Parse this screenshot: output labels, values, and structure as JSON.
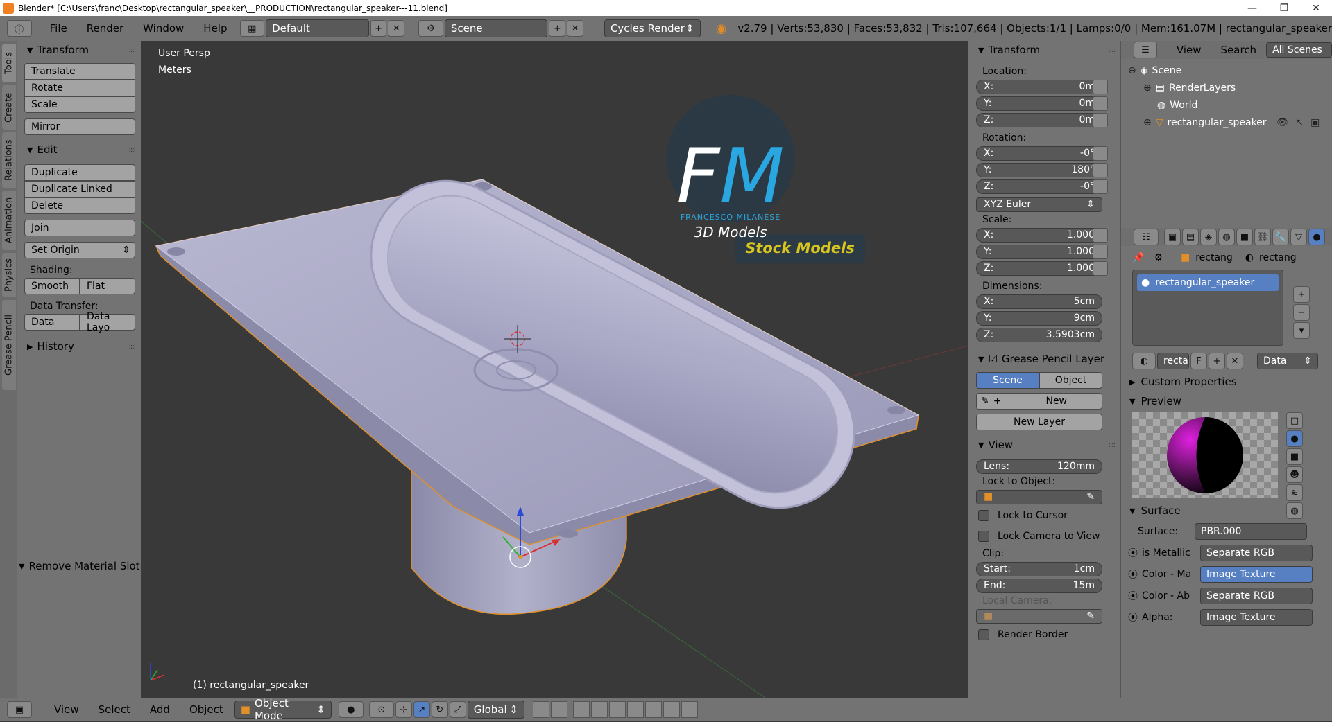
{
  "window": {
    "title": "Blender* [C:\\Users\\franc\\Desktop\\rectangular_speaker\\__PRODUCTION\\rectangular_speaker---11.blend]",
    "minimize": "—",
    "maximize": "❐",
    "close": "✕"
  },
  "topbar": {
    "menus": [
      "File",
      "Render",
      "Window",
      "Help"
    ],
    "layout": "Default",
    "scene": "Scene",
    "engine": "Cycles Render",
    "stats": "v2.79 | Verts:53,830 | Faces:53,832 | Tris:107,664 | Objects:1/1 | Lamps:0/0 | Mem:161.07M | rectangular_speaker"
  },
  "left_tabs": [
    "Tools",
    "Create",
    "Relations",
    "Animation",
    "Physics",
    "Grease Pencil"
  ],
  "toolshelf": {
    "transform_title": "Transform",
    "transform_buttons": [
      "Translate",
      "Rotate",
      "Scale"
    ],
    "mirror": "Mirror",
    "edit_title": "Edit",
    "edit_buttons": [
      "Duplicate",
      "Duplicate Linked",
      "Delete"
    ],
    "join": "Join",
    "set_origin": "Set Origin",
    "shading_label": "Shading:",
    "smooth": "Smooth",
    "flat": "Flat",
    "data_transfer_label": "Data Transfer:",
    "data": "Data",
    "data_layout": "Data Layo",
    "history": "History",
    "operator": "Remove Material Slot"
  },
  "viewport": {
    "view_name": "User Persp",
    "units": "Meters",
    "object_label": "(1) rectangular_speaker",
    "logo_letters": "FM",
    "logo_author": "FRANCESCO MILANESE",
    "logo_sub": "3D Models",
    "logo_banner": "Stock Models"
  },
  "npanel": {
    "transform_title": "Transform",
    "location_label": "Location:",
    "location": [
      {
        "axis": "X:",
        "value": "0m"
      },
      {
        "axis": "Y:",
        "value": "0m"
      },
      {
        "axis": "Z:",
        "value": "0m"
      }
    ],
    "rotation_label": "Rotation:",
    "rotation": [
      {
        "axis": "X:",
        "value": "-0°"
      },
      {
        "axis": "Y:",
        "value": "180°"
      },
      {
        "axis": "Z:",
        "value": "-0°"
      }
    ],
    "rotation_mode": "XYZ Euler",
    "scale_label": "Scale:",
    "scale": [
      {
        "axis": "X:",
        "value": "1.000"
      },
      {
        "axis": "Y:",
        "value": "1.000"
      },
      {
        "axis": "Z:",
        "value": "1.000"
      }
    ],
    "dimensions_label": "Dimensions:",
    "dimensions": [
      {
        "axis": "X:",
        "value": "5cm"
      },
      {
        "axis": "Y:",
        "value": "9cm"
      },
      {
        "axis": "Z:",
        "value": "3.5903cm"
      }
    ],
    "grease_title": "Grease Pencil Layer",
    "gp_scene": "Scene",
    "gp_object": "Object",
    "gp_new": "New",
    "gp_new_layer": "New Layer",
    "view_title": "View",
    "lens_label": "Lens:",
    "lens_value": "120mm",
    "lock_object_label": "Lock to Object:",
    "lock_cursor": "Lock to Cursor",
    "lock_camera": "Lock Camera to View",
    "clip_label": "Clip:",
    "clip_start_label": "Start:",
    "clip_start": "1cm",
    "clip_end_label": "End:",
    "clip_end": "15m",
    "local_camera": "Local Camera:",
    "render_border": "Render Border"
  },
  "outliner": {
    "view": "View",
    "search": "Search",
    "filter": "All Scenes",
    "items": [
      "Scene",
      "RenderLayers",
      "World",
      "rectangular_speaker"
    ]
  },
  "properties": {
    "breadcrumb_1": "rectang",
    "breadcrumb_2": "rectang",
    "slot": "rectangular_speaker",
    "mat_name": "recta",
    "fake_user": "F",
    "link": "Data",
    "custom_props": "Custom Properties",
    "preview": "Preview",
    "surface_title": "Surface",
    "surface_rows": [
      {
        "label": "Surface:",
        "value": "PBR.000",
        "dot": false
      },
      {
        "label": "is Metallic",
        "value": "Separate RGB",
        "dot": true
      },
      {
        "label": "Color - Ma",
        "value": "Image Texture",
        "dot": true
      },
      {
        "label": "Color - Ab",
        "value": "Separate RGB",
        "dot": true
      },
      {
        "label": "Alpha:",
        "value": "Image Texture",
        "dot": true
      }
    ]
  },
  "bottombar": {
    "menus": [
      "View",
      "Select",
      "Add",
      "Object"
    ],
    "mode": "Object Mode",
    "orientation": "Global"
  },
  "colors": {
    "panel": "#737373",
    "viewport_bg": "#393939",
    "selected_blue": "#5680c2",
    "model": "#a9a8c3",
    "logo_blue": "#2aa6e0",
    "banner_yellow": "#d8c51e"
  }
}
